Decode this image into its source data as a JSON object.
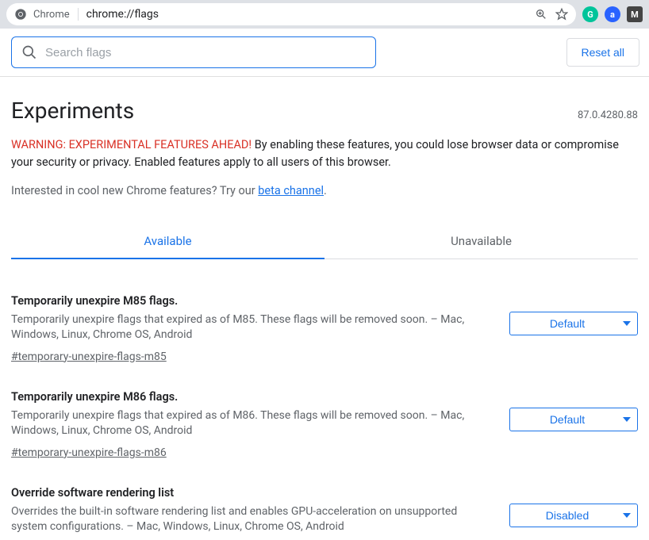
{
  "addressbar": {
    "label": "Chrome",
    "url": "chrome://flags"
  },
  "search": {
    "placeholder": "Search flags"
  },
  "reset_label": "Reset all",
  "title": "Experiments",
  "version": "87.0.4280.88",
  "warning": {
    "label": "WARNING: EXPERIMENTAL FEATURES AHEAD!",
    "text": " By enabling these features, you could lose browser data or compromise your security or privacy. Enabled features apply to all users of this browser."
  },
  "interest": {
    "prefix": "Interested in cool new Chrome features? Try our ",
    "link": "beta channel",
    "suffix": "."
  },
  "tabs": {
    "available": "Available",
    "unavailable": "Unavailable"
  },
  "flags": [
    {
      "title": "Temporarily unexpire M85 flags.",
      "desc": "Temporarily unexpire flags that expired as of M85. These flags will be removed soon. – Mac, Windows, Linux, Chrome OS, Android",
      "anchor": "#temporary-unexpire-flags-m85",
      "value": "Default"
    },
    {
      "title": "Temporarily unexpire M86 flags.",
      "desc": "Temporarily unexpire flags that expired as of M86. These flags will be removed soon. – Mac, Windows, Linux, Chrome OS, Android",
      "anchor": "#temporary-unexpire-flags-m86",
      "value": "Default"
    },
    {
      "title": "Override software rendering list",
      "desc": "Overrides the built-in software rendering list and enables GPU-acceleration on unsupported system configurations. – Mac, Windows, Linux, Chrome OS, Android",
      "anchor": "",
      "value": "Disabled"
    }
  ]
}
